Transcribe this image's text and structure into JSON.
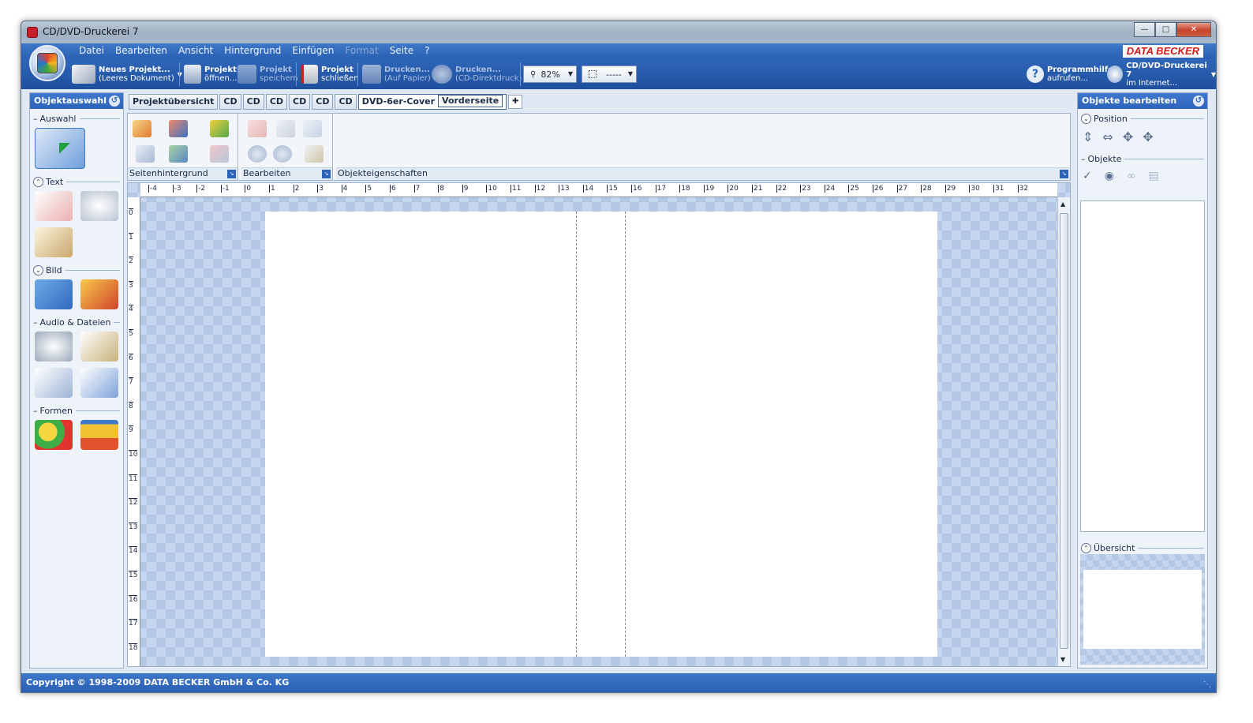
{
  "window": {
    "title": "CD/DVD-Druckerei 7"
  },
  "menu": {
    "items": [
      {
        "label": "Datei",
        "enabled": true
      },
      {
        "label": "Bearbeiten",
        "enabled": true
      },
      {
        "label": "Ansicht",
        "enabled": true
      },
      {
        "label": "Hintergrund",
        "enabled": true
      },
      {
        "label": "Einfügen",
        "enabled": true
      },
      {
        "label": "Format",
        "enabled": false
      },
      {
        "label": "Seite",
        "enabled": true
      },
      {
        "label": "?",
        "enabled": true
      }
    ],
    "brand": "DATA BECKER"
  },
  "toolbar": {
    "new_project": {
      "line1": "Neues Projekt...",
      "line2": "(Leeres Dokument)"
    },
    "open_project": {
      "line1": "Projekt",
      "line2": "öffnen..."
    },
    "save_project": {
      "line1": "Projekt",
      "line2": "speichern"
    },
    "close_project": {
      "line1": "Projekt",
      "line2": "schließen"
    },
    "print_paper": {
      "line1": "Drucken...",
      "line2": "(Auf Papier)"
    },
    "print_direct": {
      "line1": "Drucken...",
      "line2": "(CD-Direktdruck)"
    },
    "zoom": "82%",
    "line_style": "-----",
    "help": {
      "line1": "Programmhilfe",
      "line2": "aufrufen..."
    },
    "internet": {
      "line1": "CD/DVD-Druckerei 7",
      "line2": "im Internet..."
    }
  },
  "left_panel": {
    "title": "Objektauswahl",
    "sections": {
      "auswahl": "Auswahl",
      "text": "Text",
      "bild": "Bild",
      "audio": "Audio & Dateien",
      "formen": "Formen"
    }
  },
  "tabs": {
    "overview": "Projektübersicht",
    "cd": [
      "CD",
      "CD",
      "CD",
      "CD",
      "CD",
      "CD"
    ],
    "active": "DVD-6er-Cover",
    "subtab": "Vorderseite"
  },
  "ribbon": {
    "group1": "Seitenhintergrund",
    "group2": "Bearbeiten",
    "group3": "Objekteigenschaften"
  },
  "rulers": {
    "horizontal": [
      "-4",
      "-3",
      "-2",
      "-1",
      "0",
      "1",
      "2",
      "3",
      "4",
      "5",
      "6",
      "7",
      "8",
      "9",
      "10",
      "11",
      "12",
      "13",
      "14",
      "15",
      "16",
      "17",
      "18",
      "19",
      "20",
      "21",
      "22",
      "23",
      "24",
      "25",
      "26",
      "27",
      "28",
      "29",
      "30",
      "31",
      "32"
    ],
    "vertical": [
      "0",
      "1",
      "2",
      "3",
      "4",
      "5",
      "6",
      "7",
      "8",
      "9",
      "10",
      "11",
      "12",
      "13",
      "14",
      "15",
      "16",
      "17",
      "18"
    ]
  },
  "right_panel": {
    "title": "Objekte bearbeiten",
    "position": "Position",
    "objects": "Objekte",
    "overview": "Übersicht"
  },
  "status": {
    "copyright": "Copyright © 1998-2009 DATA BECKER GmbH & Co. KG"
  },
  "colors": {
    "accent": "#2b60b4",
    "brand_red": "#d21a1a",
    "checker": "#c5d6ee"
  }
}
